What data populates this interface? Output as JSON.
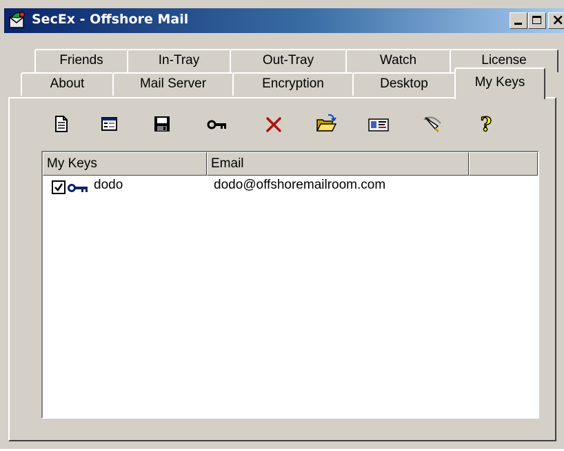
{
  "window": {
    "title": "SecEx - Offshore Mail",
    "title_bar_color": "#0a246a",
    "face_color": "#d4d0c8",
    "controls": [
      "minimize-icon",
      "maximize-icon",
      "close-icon"
    ]
  },
  "tabs": {
    "row1": [
      "Friends",
      "In-Tray",
      "Out-Tray",
      "Watch",
      "License"
    ],
    "row2": [
      "About",
      "Mail Server",
      "Encryption",
      "Desktop",
      "My Keys"
    ],
    "active": "My Keys"
  },
  "toolbar": {
    "icons": [
      "new-document-icon",
      "properties-icon",
      "save-icon",
      "key-icon",
      "delete-icon",
      "open-folder-icon",
      "card-icon",
      "signature-pen-icon",
      "help-icon"
    ],
    "help_glyph": "?"
  },
  "list": {
    "columns": [
      "My Keys",
      "Email"
    ],
    "rows": [
      {
        "checked": true,
        "icon": "key-icon",
        "name": "dodo",
        "email": "dodo@offshoremailroom.com"
      }
    ]
  }
}
